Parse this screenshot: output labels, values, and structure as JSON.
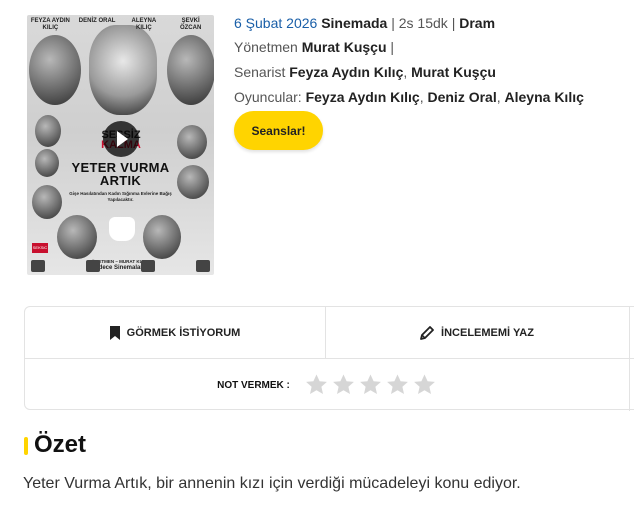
{
  "poster": {
    "cast_names": [
      "FEYZA AYDIN KILIÇ",
      "DENİZ ORAL",
      "ALEYNA KILIÇ",
      "ŞEVKİ ÖZCAN"
    ],
    "sessiz": "SESSİZ",
    "kalma": "KALMA",
    "title_line1": "YETER VURMA",
    "title_line2": "ARTIK",
    "tagline": "Gişe Hasılatından Kadın Sığınma Evlerine Bağış Yapılacaktır.",
    "director_credit": "YÖNETMEN – MURAT KUŞÇU",
    "release_note": "Sadece Sinemalarda",
    "logo_text": "SEKSiC"
  },
  "movie": {
    "release_date": "6 Şubat 2026",
    "status": "Sinemada",
    "duration": "2s 15dk",
    "genre": "Dram",
    "separator": "|",
    "director_label": "Yönetmen",
    "director": "Murat Kuşçu",
    "writer_label": "Senarist",
    "writers": [
      "Feyza Aydın Kılıç",
      "Murat Kuşçu"
    ],
    "cast_label": "Oyuncular:",
    "cast": [
      "Feyza Aydın Kılıç",
      "Deniz Oral",
      "Aleyna Kılıç"
    ],
    "comma": ","
  },
  "actions": {
    "showtimes_label": "Seanslar!",
    "watchlist_label": "GÖRMEK İSTİYORUM",
    "review_label": "İNCELEMEMİ YAZ",
    "rating_label": "NOT VERMEK :",
    "rating_stars": 5,
    "rating_value": 0
  },
  "summary": {
    "heading": "Özet",
    "text": "Yeter Vurma Artık, bir annenin kızı için verdiği mücadeleyi konu ediyor."
  },
  "colors": {
    "accent": "#ffd400",
    "link": "#1a5fa8",
    "star_empty": "#d6d6d6"
  },
  "icons": {
    "watchlist": "bookmark-icon",
    "review": "pencil-icon",
    "poster_play": "play-icon",
    "rating": "star-icon"
  }
}
